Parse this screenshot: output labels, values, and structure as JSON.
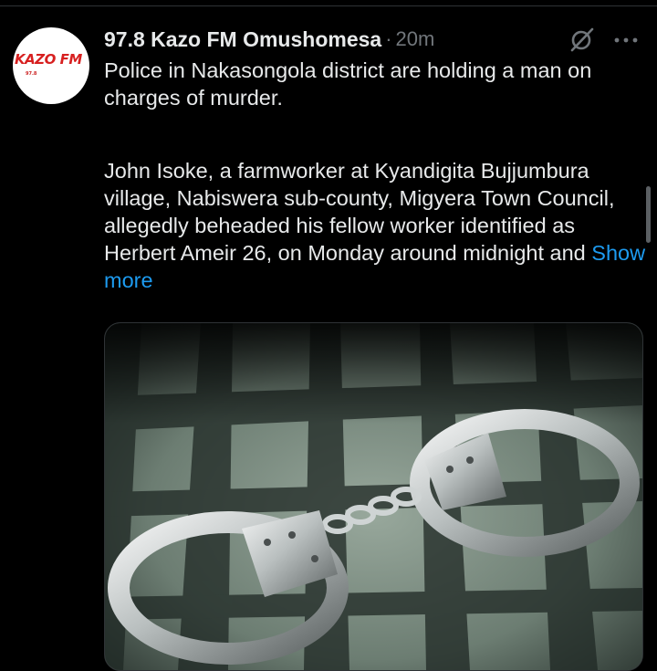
{
  "post": {
    "author_name": "97.8 Kazo FM Omushomesa",
    "separator": "·",
    "time": "20m",
    "paragraph1": "Police in Nakasongola district are holding a man on charges of murder.",
    "paragraph2": "John Isoke, a farmworker at Kyandigita Bujjumbura village, Nabiswera sub-county, Migyera Town Council, allegedly beheaded his fellow worker identified as Herbert Ameir 26, on Monday around midnight and",
    "show_more": "Show more"
  },
  "avatar": {
    "logo_text": "KAZO FM",
    "sub_text": "97.8"
  },
  "icons": {
    "grok": "grok-icon",
    "more": "more-options-icon"
  },
  "colors": {
    "background": "#000000",
    "text": "#e7e9ea",
    "secondary": "#71767b",
    "link": "#1d9bf0",
    "logo_red": "#d72020"
  }
}
